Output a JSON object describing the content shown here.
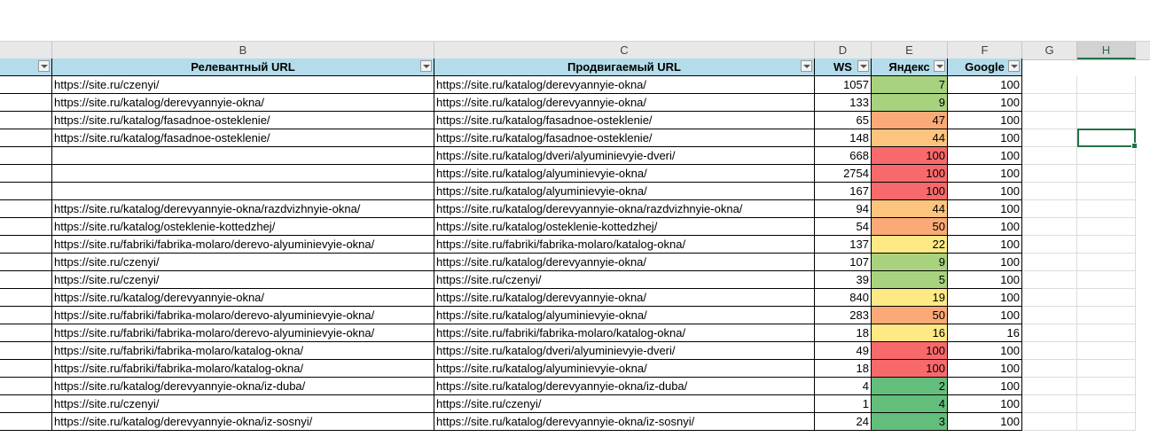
{
  "columns": [
    "B",
    "C",
    "D",
    "E",
    "F",
    "G",
    "H"
  ],
  "selected_column": "H",
  "headers": {
    "a": "",
    "b": "Релевантный URL",
    "c": "Продвигаемый URL",
    "d": "WS",
    "e": "Яндекс",
    "f": "Google"
  },
  "colors": {
    "green": "#63be7b",
    "lightgreen": "#a9d27f",
    "yellow": "#ffe984",
    "lightorange": "#fdc47d",
    "orange": "#fbaa77",
    "red": "#f8696b"
  },
  "rows": [
    {
      "b": "https://site.ru/czenyi/",
      "c": "https://site.ru/katalog/derevyannyie-okna/",
      "d": "1057",
      "e": "7",
      "f": "100"
    },
    {
      "b": "https://site.ru/katalog/derevyannyie-okna/",
      "c": "https://site.ru/katalog/derevyannyie-okna/",
      "d": "133",
      "e": "9",
      "f": "100"
    },
    {
      "b": "https://site.ru/katalog/fasadnoe-osteklenie/",
      "c": "https://site.ru/katalog/fasadnoe-osteklenie/",
      "d": "65",
      "e": "47",
      "f": "100"
    },
    {
      "b": "https://site.ru/katalog/fasadnoe-osteklenie/",
      "c": "https://site.ru/katalog/fasadnoe-osteklenie/",
      "d": "148",
      "e": "44",
      "f": "100"
    },
    {
      "b": "",
      "c": "https://site.ru/katalog/dveri/alyuminievyie-dveri/",
      "d": "668",
      "e": "100",
      "f": "100"
    },
    {
      "b": "",
      "c": "https://site.ru/katalog/alyuminievyie-okna/",
      "d": "2754",
      "e": "100",
      "f": "100"
    },
    {
      "b": "",
      "c": "https://site.ru/katalog/alyuminievyie-okna/",
      "d": "167",
      "e": "100",
      "f": "100"
    },
    {
      "b": "https://site.ru/katalog/derevyannyie-okna/razdvizhnyie-okna/",
      "c": "https://site.ru/katalog/derevyannyie-okna/razdvizhnyie-okna/",
      "d": "94",
      "e": "44",
      "f": "100"
    },
    {
      "b": "https://site.ru/katalog/osteklenie-kottedzhej/",
      "c": "https://site.ru/katalog/osteklenie-kottedzhej/",
      "d": "54",
      "e": "50",
      "f": "100"
    },
    {
      "b": "https://site.ru/fabriki/fabrika-molaro/derevo-alyuminievyie-okna/",
      "c": "https://site.ru/fabriki/fabrika-molaro/katalog-okna/",
      "d": "137",
      "e": "22",
      "f": "100"
    },
    {
      "b": "https://site.ru/czenyi/",
      "c": "https://site.ru/katalog/derevyannyie-okna/",
      "d": "107",
      "e": "9",
      "f": "100"
    },
    {
      "b": "https://site.ru/czenyi/",
      "c": "https://site.ru/czenyi/",
      "d": "39",
      "e": "5",
      "f": "100"
    },
    {
      "b": "https://site.ru/katalog/derevyannyie-okna/",
      "c": "https://site.ru/katalog/derevyannyie-okna/",
      "d": "840",
      "e": "19",
      "f": "100"
    },
    {
      "b": "https://site.ru/fabriki/fabrika-molaro/derevo-alyuminievyie-okna/",
      "c": "https://site.ru/katalog/alyuminievyie-okna/",
      "d": "283",
      "e": "50",
      "f": "100"
    },
    {
      "b": "https://site.ru/fabriki/fabrika-molaro/derevo-alyuminievyie-okna/",
      "c": "https://site.ru/fabriki/fabrika-molaro/katalog-okna/",
      "d": "18",
      "e": "16",
      "f": "16"
    },
    {
      "b": "https://site.ru/fabriki/fabrika-molaro/katalog-okna/",
      "c": "https://site.ru/katalog/dveri/alyuminievyie-dveri/",
      "d": "49",
      "e": "100",
      "f": "100"
    },
    {
      "b": "https://site.ru/fabriki/fabrika-molaro/katalog-okna/",
      "c": "https://site.ru/katalog/alyuminievyie-okna/",
      "d": "18",
      "e": "100",
      "f": "100"
    },
    {
      "b": "https://site.ru/katalog/derevyannyie-okna/iz-duba/",
      "c": "https://site.ru/katalog/derevyannyie-okna/iz-duba/",
      "d": "4",
      "e": "2",
      "f": "100"
    },
    {
      "b": "https://site.ru/czenyi/",
      "c": "https://site.ru/czenyi/",
      "d": "1",
      "e": "4",
      "f": "100"
    },
    {
      "b": "https://site.ru/katalog/derevyannyie-okna/iz-sosnyi/",
      "c": "https://site.ru/katalog/derevyannyie-okna/iz-sosnyi/",
      "d": "24",
      "e": "3",
      "f": "100"
    }
  ]
}
